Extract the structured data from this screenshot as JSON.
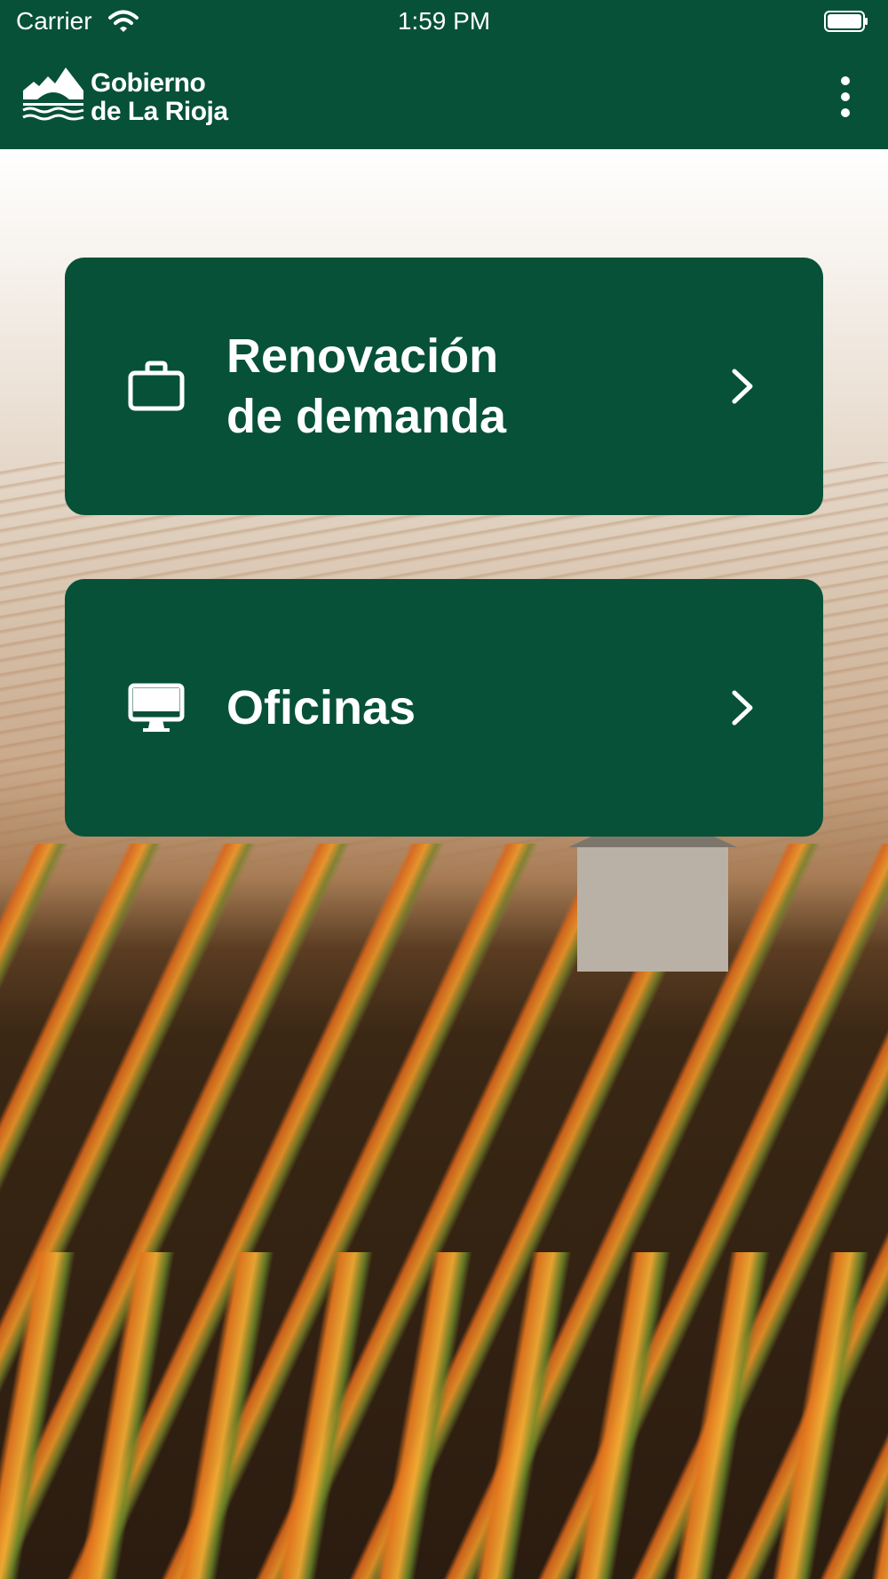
{
  "status_bar": {
    "carrier": "Carrier",
    "time": "1:59 PM"
  },
  "app_bar": {
    "brand_line1": "Gobierno",
    "brand_line2": "de La Rioja",
    "menu_icon": "kebab-vertical-icon"
  },
  "menu": [
    {
      "label": "Renovación\nde demanda",
      "icon": "briefcase-icon"
    },
    {
      "label": "Oficinas",
      "icon": "monitor-icon"
    }
  ],
  "colors": {
    "primary": "#065138",
    "text_on_primary": "#ffffff"
  }
}
